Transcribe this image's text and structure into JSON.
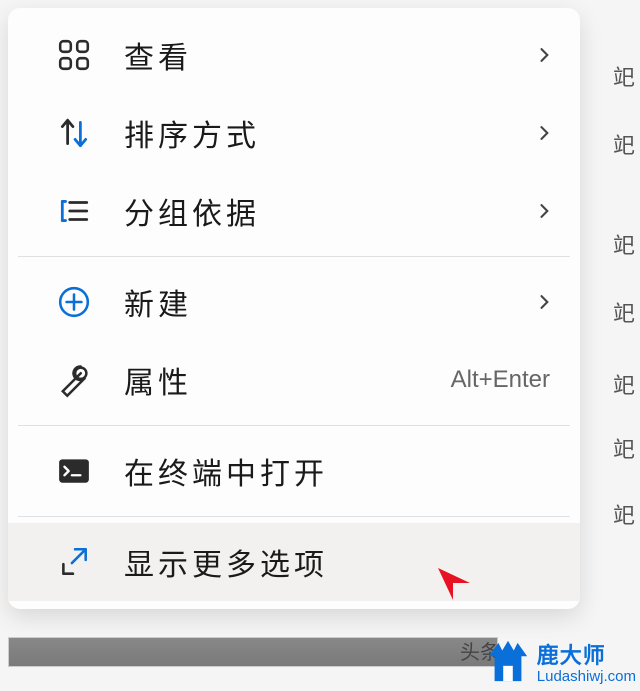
{
  "menu": {
    "view": {
      "label": "查看",
      "has_submenu": true
    },
    "sort": {
      "label": "排序方式",
      "has_submenu": true
    },
    "group": {
      "label": "分组依据",
      "has_submenu": true
    },
    "new": {
      "label": "新建",
      "has_submenu": true
    },
    "properties": {
      "label": "属性",
      "shortcut": "Alt+Enter"
    },
    "terminal": {
      "label": "在终端中打开"
    },
    "more": {
      "label": "显示更多选项"
    }
  },
  "watermark": {
    "name": "鹿大师",
    "url": "Ludashiwj.com"
  },
  "footer": "头条"
}
